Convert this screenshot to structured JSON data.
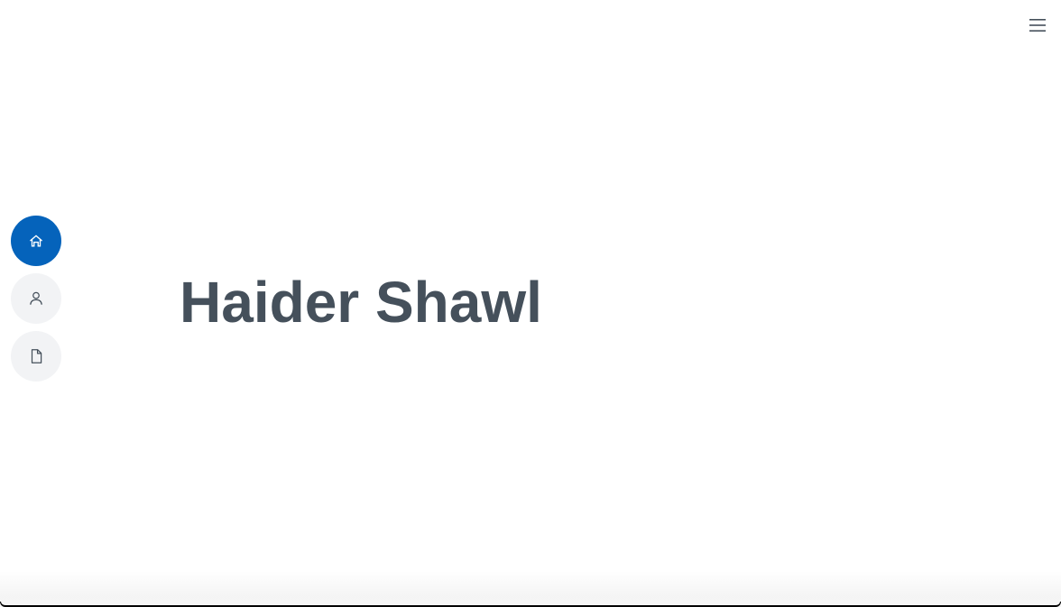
{
  "header": {
    "menu_icon": "hamburger-menu-icon"
  },
  "nav": {
    "items": [
      {
        "icon": "home-icon",
        "active": true
      },
      {
        "icon": "user-icon",
        "active": false
      },
      {
        "icon": "file-icon",
        "active": false
      }
    ]
  },
  "hero": {
    "name": "Haider Shawl"
  },
  "colors": {
    "accent": "#0563bb",
    "nav_inactive_bg": "#f2f3f5",
    "title_text": "#45505b",
    "icon_dark": "#45505b",
    "icon_light": "#ffffff"
  }
}
